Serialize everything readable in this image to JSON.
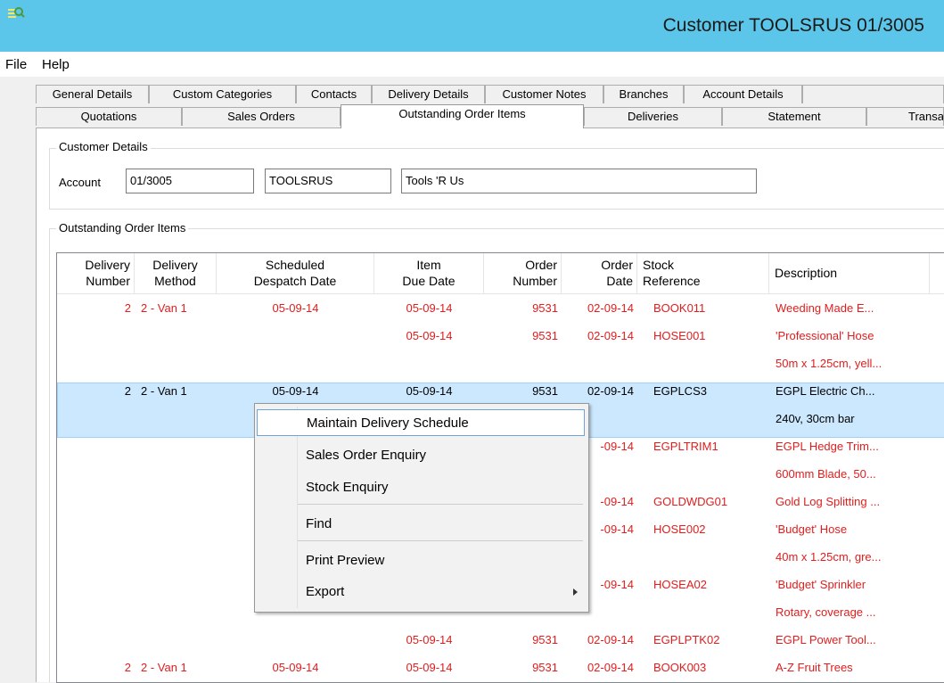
{
  "window": {
    "title": "Customer TOOLSRUS 01/3005"
  },
  "menu": {
    "file": "File",
    "help": "Help"
  },
  "tabs_row1": [
    "General Details",
    "Custom Categories",
    "Contacts",
    "Delivery Details",
    "Customer Notes",
    "Branches",
    "Account Details"
  ],
  "tabs_row2": [
    "Quotations",
    "Sales Orders",
    "Outstanding Order Items",
    "Deliveries",
    "Statement",
    "Transa"
  ],
  "customer": {
    "group_label": "Customer Details",
    "account_label": "Account",
    "account": "01/3005",
    "code": "TOOLSRUS",
    "name": "Tools 'R Us"
  },
  "items": {
    "group_label": "Outstanding Order Items",
    "headers": {
      "delivery_number": "Delivery\nNumber",
      "delivery_method": "Delivery\nMethod",
      "scheduled_despatch": "Scheduled\nDespatch Date",
      "item_due": "Item\nDue Date",
      "order_number": "Order\nNumber",
      "order_date": "Order\nDate",
      "stock_ref": "Stock\nReference",
      "description": "Description"
    },
    "rows": [
      {
        "dn": "2",
        "dm": "2 - Van 1",
        "sd": "05-09-14",
        "due": "05-09-14",
        "on": "9531",
        "od": "02-09-14",
        "ref": "BOOK011",
        "desc": "Weeding Made E...",
        "color": "red"
      },
      {
        "dn": "",
        "dm": "",
        "sd": "",
        "due": "05-09-14",
        "on": "9531",
        "od": "02-09-14",
        "ref": "HOSE001",
        "desc": "'Professional' Hose",
        "color": "red"
      },
      {
        "dn": "",
        "dm": "",
        "sd": "",
        "due": "",
        "on": "",
        "od": "",
        "ref": "",
        "desc": "50m x 1.25cm, yell...",
        "color": "red"
      },
      {
        "dn": "2",
        "dm": "2 - Van 1",
        "sd": "05-09-14",
        "due": "05-09-14",
        "on": "9531",
        "od": "02-09-14",
        "ref": "EGPLCS3",
        "desc": "EGPL Electric Ch...",
        "color": "black"
      },
      {
        "dn": "",
        "dm": "",
        "sd": "",
        "due": "",
        "on": "",
        "od": "",
        "ref": "",
        "desc": "240v, 30cm bar",
        "color": "black"
      },
      {
        "dn": "",
        "dm": "",
        "sd": "",
        "due": "",
        "on": "",
        "od": "-09-14",
        "ref": "EGPLTRIM1",
        "desc": "EGPL Hedge Trim...",
        "color": "red"
      },
      {
        "dn": "",
        "dm": "",
        "sd": "",
        "due": "",
        "on": "",
        "od": "",
        "ref": "",
        "desc": "600mm Blade, 50...",
        "color": "red"
      },
      {
        "dn": "",
        "dm": "",
        "sd": "",
        "due": "",
        "on": "",
        "od": "-09-14",
        "ref": "GOLDWDG01",
        "desc": "Gold Log Splitting ...",
        "color": "red"
      },
      {
        "dn": "",
        "dm": "",
        "sd": "",
        "due": "",
        "on": "",
        "od": "-09-14",
        "ref": "HOSE002",
        "desc": "'Budget' Hose",
        "color": "red"
      },
      {
        "dn": "",
        "dm": "",
        "sd": "",
        "due": "",
        "on": "",
        "od": "",
        "ref": "",
        "desc": "40m x 1.25cm, gre...",
        "color": "red"
      },
      {
        "dn": "",
        "dm": "",
        "sd": "",
        "due": "",
        "on": "",
        "od": "-09-14",
        "ref": "HOSEA02",
        "desc": "'Budget' Sprinkler",
        "color": "red"
      },
      {
        "dn": "",
        "dm": "",
        "sd": "",
        "due": "",
        "on": "",
        "od": "",
        "ref": "",
        "desc": "Rotary, coverage ...",
        "color": "red"
      },
      {
        "dn": "",
        "dm": "",
        "sd": "",
        "due": "05-09-14",
        "on": "9531",
        "od": "02-09-14",
        "ref": "EGPLPTK02",
        "desc": "EGPL Power Tool...",
        "color": "red"
      },
      {
        "dn": "2",
        "dm": "2 - Van 1",
        "sd": "05-09-14",
        "due": "05-09-14",
        "on": "9531",
        "od": "02-09-14",
        "ref": "BOOK003",
        "desc": "A-Z Fruit Trees",
        "color": "red"
      }
    ]
  },
  "context_menu": {
    "maintain": "Maintain Delivery Schedule",
    "sales_enquiry": "Sales Order Enquiry",
    "stock_enquiry": "Stock Enquiry",
    "find": "Find",
    "print_preview": "Print Preview",
    "export": "Export"
  }
}
